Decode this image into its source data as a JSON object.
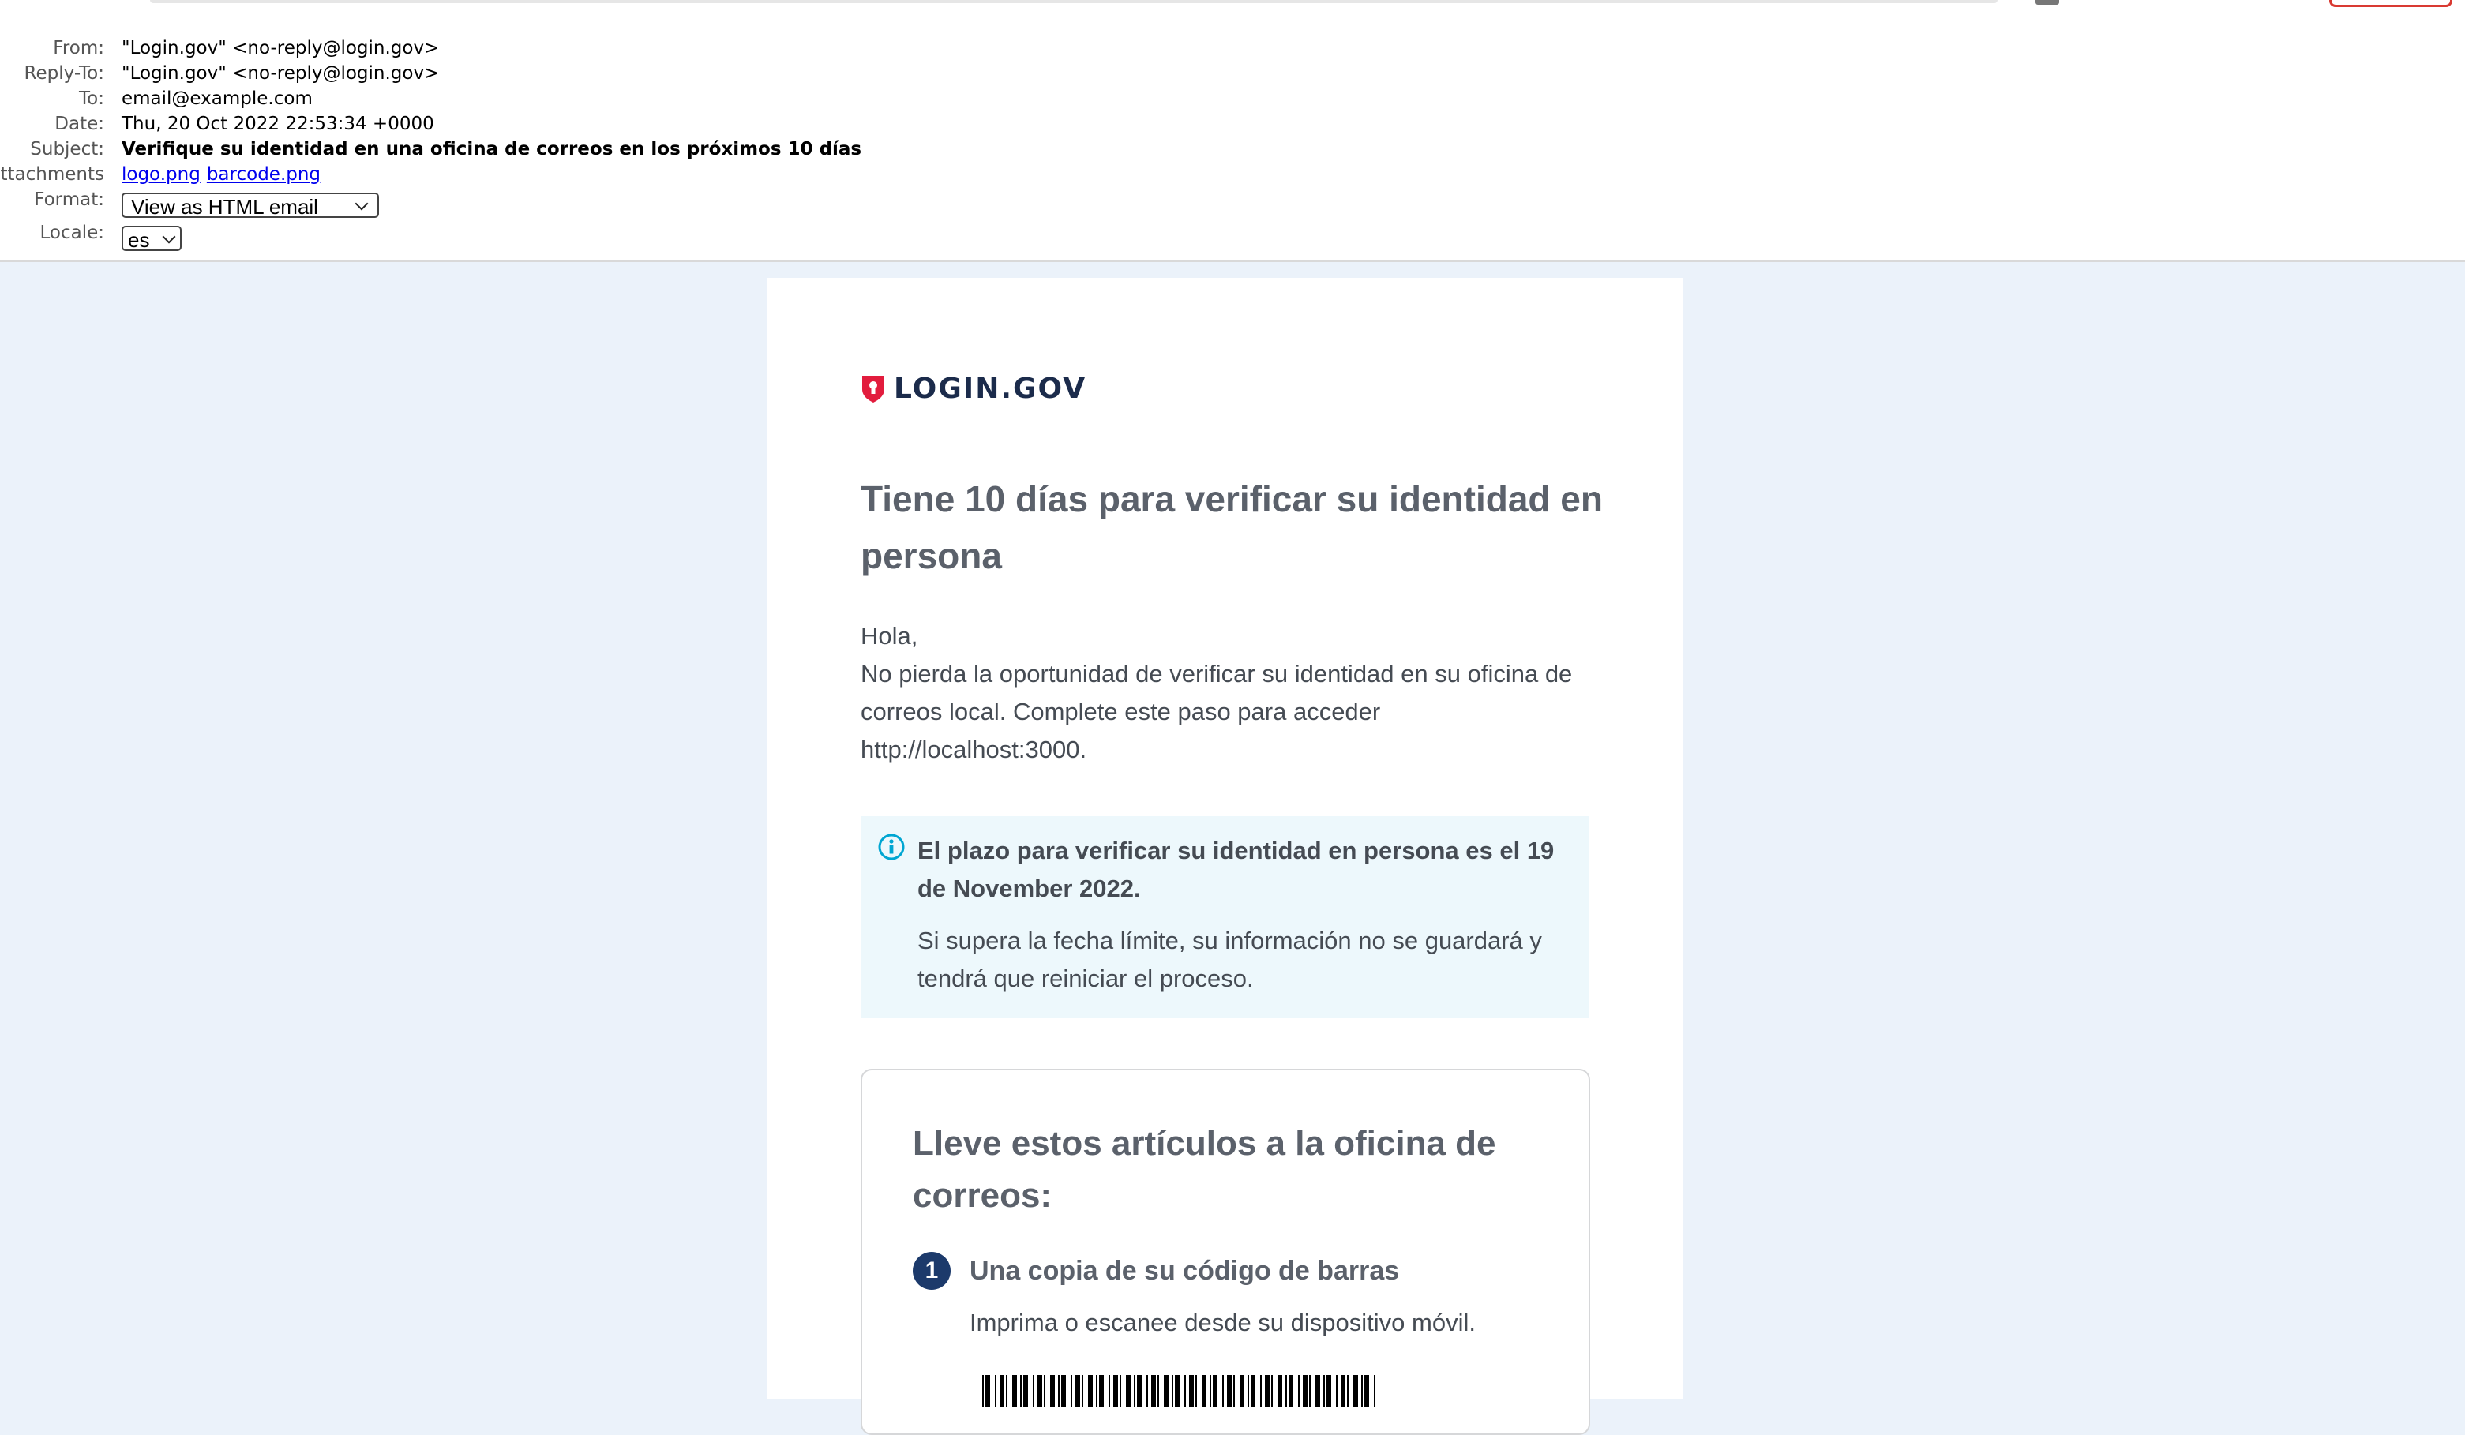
{
  "header": {
    "from_label": "From:",
    "from_value": "\"Login.gov\" <no-reply@login.gov>",
    "reply_to_label": "Reply-To:",
    "reply_to_value": "\"Login.gov\" <no-reply@login.gov>",
    "to_label": "To:",
    "to_value": "email@example.com",
    "date_label": "Date:",
    "date_value": "Thu, 20 Oct 2022 22:53:34 +0000",
    "subject_label": "Subject:",
    "subject_value": "Verifique su identidad en una oficina de correos en los próximos 10 días",
    "attachments_label": "ttachments:",
    "attachments": [
      "logo.png",
      "barcode.png"
    ],
    "format_label": "Format:",
    "format_selected": "View as HTML email",
    "locale_label": "Locale:",
    "locale_selected": "es"
  },
  "email": {
    "logo_text": "LOGIN.GOV",
    "headline": "Tiene 10 días para verificar su identidad en persona",
    "greeting": "Hola,",
    "intro": "No pierda la oportunidad de verificar su identidad en su oficina de correos local. Complete este paso para acceder http://localhost:3000.",
    "alert_title": "El plazo para verificar su identidad en persona es el 19 de November 2022.",
    "alert_body": "Si supera la fecha límite, su información no se guardará y tendrá que reiniciar el proceso.",
    "items_title": "Lleve estos artículos a la oficina de correos:",
    "step_number": "1",
    "step_title": "Una copia de su código de barras",
    "step_desc": "Imprima o escanee desde su dispositivo móvil."
  },
  "colors": {
    "page_background": "#ebf2fa",
    "logo_shield": "#e21c3d",
    "logo_text": "#1b2b4b",
    "alert_background": "#edf8fc",
    "info_icon": "#00a6d2",
    "step_badge": "#1c3a6b"
  },
  "icons": [
    "shield-logo-icon",
    "info-icon",
    "chevron-down-icon"
  ]
}
